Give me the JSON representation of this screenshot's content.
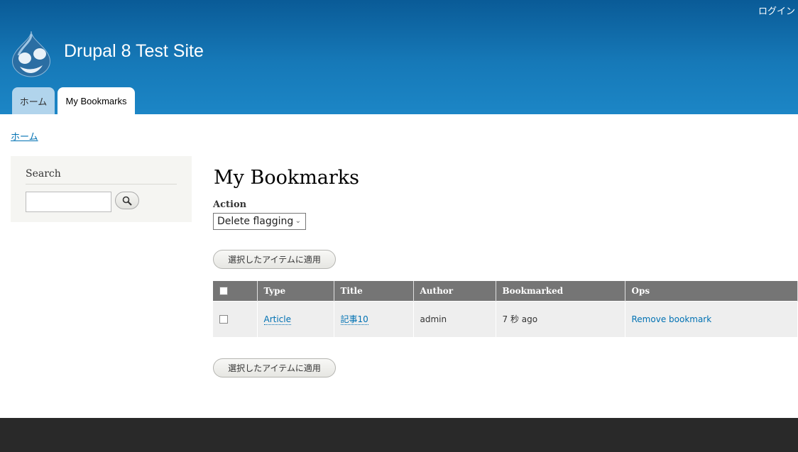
{
  "header": {
    "login_label": "ログイン",
    "site_name": "Drupal 8 Test Site",
    "tabs": [
      {
        "label": "ホーム"
      },
      {
        "label": "My Bookmarks"
      }
    ],
    "logo_icon": "drupal-drop-logo"
  },
  "breadcrumb": {
    "home_label": "ホーム"
  },
  "sidebar": {
    "search_title": "Search",
    "search_input_value": "",
    "search_icon": "magnifier-icon"
  },
  "main": {
    "title": "My Bookmarks",
    "action_label": "Action",
    "action_selected": "Delete flagging",
    "apply_label": "選択したアイテムに適用",
    "table": {
      "headers": [
        "Type",
        "Title",
        "Author",
        "Bookmarked",
        "Ops"
      ],
      "rows": [
        {
          "type": "Article",
          "title": "記事10",
          "author": "admin",
          "bookmarked": "7 秒 ago",
          "ops": "Remove bookmark"
        }
      ]
    }
  },
  "colors": {
    "header_top": "#0a5b97",
    "header_bottom": "#1c86c6",
    "link": "#0071b3",
    "table_header": "#757575",
    "footer": "#292929"
  }
}
